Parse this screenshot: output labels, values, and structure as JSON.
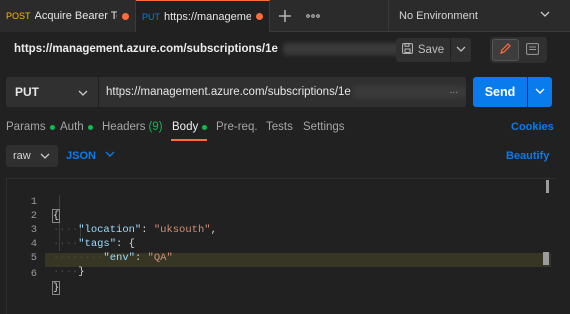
{
  "tabs": [
    {
      "method": "POST",
      "title": "Acquire Bearer Token",
      "unsaved": true
    },
    {
      "method": "PUT",
      "title": "https://management.az",
      "unsaved": true,
      "active": true
    }
  ],
  "environment": {
    "label": "No Environment"
  },
  "request": {
    "title": "https://management.azure.com/subscriptions/1e",
    "save_label": "Save",
    "method": "PUT",
    "url": "https://management.azure.com/subscriptions/1e",
    "url_more": "...",
    "send_label": "Send"
  },
  "request_tabs": {
    "params": "Params",
    "auth": "Auth",
    "headers": "Headers",
    "headers_count": "(9)",
    "body": "Body",
    "prereq": "Pre-req.",
    "tests": "Tests",
    "settings": "Settings",
    "cookies": "Cookies"
  },
  "body_options": {
    "mode": "raw",
    "language": "JSON",
    "beautify": "Beautify"
  },
  "editor": {
    "line_numbers": [
      "1",
      "2",
      "3",
      "4",
      "5",
      "6"
    ],
    "location_key": "\"location\"",
    "location_value": "\"uksouth\"",
    "tags_key": "\"tags\"",
    "env_key": "\"env\"",
    "env_value": "\"QA\""
  },
  "colors": {
    "accent_orange": "#ff6c37",
    "accent_blue": "#097bed",
    "green": "#0cbb52"
  },
  "icons": [
    "plus-icon",
    "more-icon",
    "chevron-down-icon",
    "save-icon",
    "pencil-icon",
    "comment-icon"
  ]
}
